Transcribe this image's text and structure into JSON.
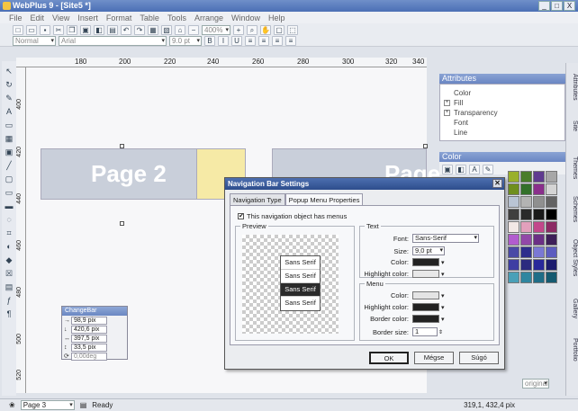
{
  "window": {
    "title": "WebPlus 9 - [Site5 *]",
    "min": "_",
    "max": "□",
    "close": "X"
  },
  "menu": [
    "File",
    "Edit",
    "View",
    "Insert",
    "Format",
    "Table",
    "Tools",
    "Arrange",
    "Window",
    "Help"
  ],
  "toolbar": {
    "zoom": "400%",
    "style": "Normal",
    "font": "Arial",
    "size": "9.0 pt"
  },
  "ruler": {
    "h": [
      "180",
      "200",
      "220",
      "240",
      "260",
      "280",
      "300",
      "320",
      "340"
    ],
    "v": [
      "400",
      "420",
      "440",
      "460",
      "480",
      "500",
      "520"
    ]
  },
  "canvas": {
    "page2_label": "Page 2",
    "page3_label": "Page 3"
  },
  "changebar": {
    "title": "ChangeBar",
    "rows": [
      {
        "icon": "→",
        "value": "98,9 pix"
      },
      {
        "icon": "↓",
        "value": "420,6 pix"
      },
      {
        "icon": "↔",
        "value": "397,5 pix"
      },
      {
        "icon": "↕",
        "value": "33,5 pix"
      },
      {
        "icon": "⟳",
        "value": "0,00deg"
      }
    ]
  },
  "attributes": {
    "title": "Attributes",
    "items": [
      {
        "label": "Color",
        "expand": ""
      },
      {
        "label": "Fill",
        "expand": "+"
      },
      {
        "label": "Transparency",
        "expand": "+"
      },
      {
        "label": "Font",
        "expand": ""
      },
      {
        "label": "Line",
        "expand": ""
      }
    ]
  },
  "color_panel": {
    "title": "Color",
    "swatches": [
      "#9ab02c",
      "#4a7d2a",
      "#5f3b8f",
      "#a7a7a7",
      "#6f8f1e",
      "#33702a",
      "#8a2f8c",
      "#d4d4d4",
      "#b9c4d4",
      "#b3b3b3",
      "#8f8f8f",
      "#636363",
      "#3f3f3f",
      "#2a2a2a",
      "#1a1a1a",
      "#000000",
      "#f2e8e6",
      "#e2a0bc",
      "#c2478b",
      "#8c2a64",
      "#b25ccf",
      "#9248a8",
      "#6b2f85",
      "#3d1f58",
      "#4a4aa6",
      "#2e2e8c",
      "#7a78d4",
      "#5c5cbf",
      "#3e3ea3",
      "#2b2b7f",
      "#28289a",
      "#1c1c6e",
      "#4aa0b8",
      "#2f86a0",
      "#1f6d87",
      "#155a70"
    ]
  },
  "righttabs": [
    "Attributes",
    "Site",
    "Themes",
    "Schemes",
    "Object Styles",
    "Gallery",
    "Portfolio"
  ],
  "status": {
    "page": "Page 3",
    "state": "Ready",
    "coords": "319,1, 432,4 pix",
    "zoom": "original"
  },
  "dialog": {
    "title": "Navigation Bar Settings",
    "tabs": [
      "Navigation Type",
      "Popup Menu Properties"
    ],
    "has_menus_label": "This navigation object has menus",
    "has_menus_checked": "✔",
    "preview_label": "Preview",
    "preview_items": [
      "Sans Serif",
      "Sans Serif",
      "Sans Serif",
      "Sans Serif"
    ],
    "text_group": "Text",
    "font_label": "Font:",
    "font_value": "Sans-Serif",
    "size_label": "Size:",
    "size_value": "9,0 pt",
    "color_label": "Color:",
    "highlight_label": "Highlight color:",
    "menu_group": "Menu",
    "menu_color_label": "Color:",
    "menu_highlight_label": "Highlight color:",
    "border_color_label": "Border color:",
    "border_size_label": "Border size:",
    "border_size_value": "1",
    "ok": "OK",
    "cancel": "Mégse",
    "help": "Súgó"
  },
  "colors": {
    "accent": "#4d6fb0",
    "selected": "#2b2b2b"
  }
}
